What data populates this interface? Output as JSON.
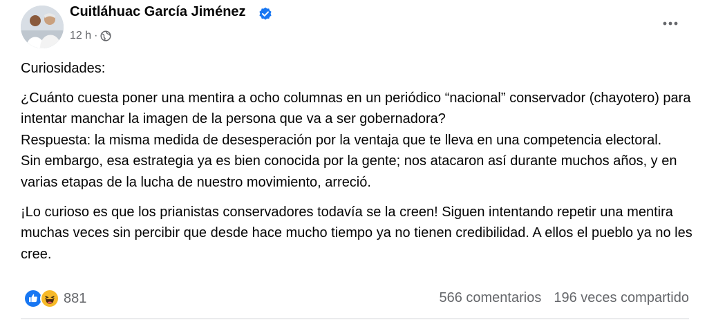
{
  "post": {
    "author": "Cuitláhuac García Jiménez",
    "time": "12 h",
    "separator": "·",
    "privacy_icon": "globe-icon",
    "verified_icon": "verified-badge-icon",
    "more_icon": "more-options-icon",
    "paragraphs": [
      "Curiosidades:",
      "¿Cuánto cuesta poner una mentira a ocho columnas en un periódico “nacional” conservador (chayotero) para intentar manchar la imagen de la persona que va a ser gobernadora?",
      "Respuesta: la misma medida de desesperación por la ventaja que te lleva en una competencia electoral.",
      "Sin embargo, esa estrategia ya es bien conocida por la gente; nos atacaron así durante muchos años, y en varias etapas de la lucha de nuestro movimiento, arreció.",
      "¡Lo curioso es que los prianistas conservadores todavía se la creen! Siguen intentando repetir una mentira muchas veces sin percibir que desde hace mucho tiempo ya no tienen credibilidad. A ellos el pueblo ya no les cree."
    ]
  },
  "footer": {
    "reaction_icons": [
      "like-icon",
      "haha-icon"
    ],
    "reaction_count": "881",
    "comments": "566 comentarios",
    "shares": "196 veces compartido"
  },
  "colors": {
    "secondary_text": "#65676b",
    "like_blue": "#1877f2",
    "haha_yellow": "#f7b928",
    "divider": "#ced0d4"
  }
}
